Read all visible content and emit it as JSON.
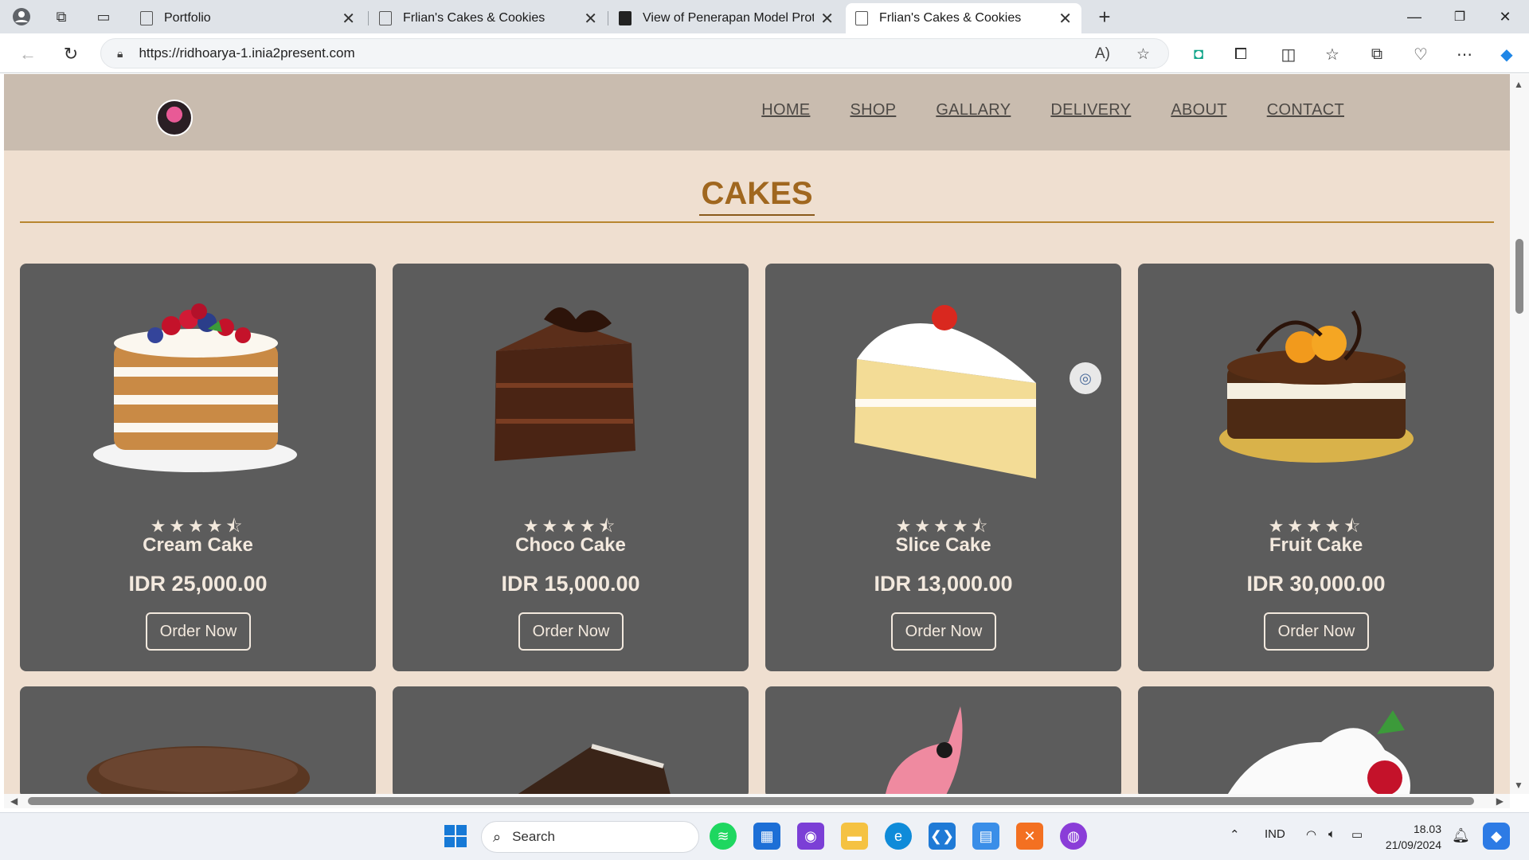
{
  "browser": {
    "tabs": [
      {
        "title": "Portfolio",
        "active": false
      },
      {
        "title": "Frlian's Cakes & Cookies",
        "active": false
      },
      {
        "title": "View of Penerapan Model Prototy",
        "active": false
      },
      {
        "title": "Frlian's Cakes & Cookies",
        "active": true
      }
    ],
    "url": "https://ridhoarya-1.inia2present.com"
  },
  "site": {
    "nav": [
      "HOME",
      "SHOP",
      "GALLARY",
      "DELIVERY",
      "ABOUT",
      "CONTACT"
    ],
    "section_title": "CAKES",
    "cards": [
      {
        "name": "Cream Cake",
        "price": "IDR 25,000.00",
        "rating": 4.5,
        "button": "Order Now"
      },
      {
        "name": "Choco Cake",
        "price": "IDR 15,000.00",
        "rating": 4.5,
        "button": "Order Now"
      },
      {
        "name": "Slice Cake",
        "price": "IDR 13,000.00",
        "rating": 4.5,
        "button": "Order Now"
      },
      {
        "name": "Fruit Cake",
        "price": "IDR 30,000.00",
        "rating": 4.5,
        "button": "Order Now"
      }
    ]
  },
  "taskbar": {
    "search_placeholder": "Search",
    "language": "IND",
    "time": "18.03",
    "date": "21/09/2024"
  },
  "colors": {
    "page_bg": "#efdfd0",
    "header_bg": "#c9bcaf",
    "card_bg": "#5c5c5c",
    "title_color": "#a0671f"
  }
}
